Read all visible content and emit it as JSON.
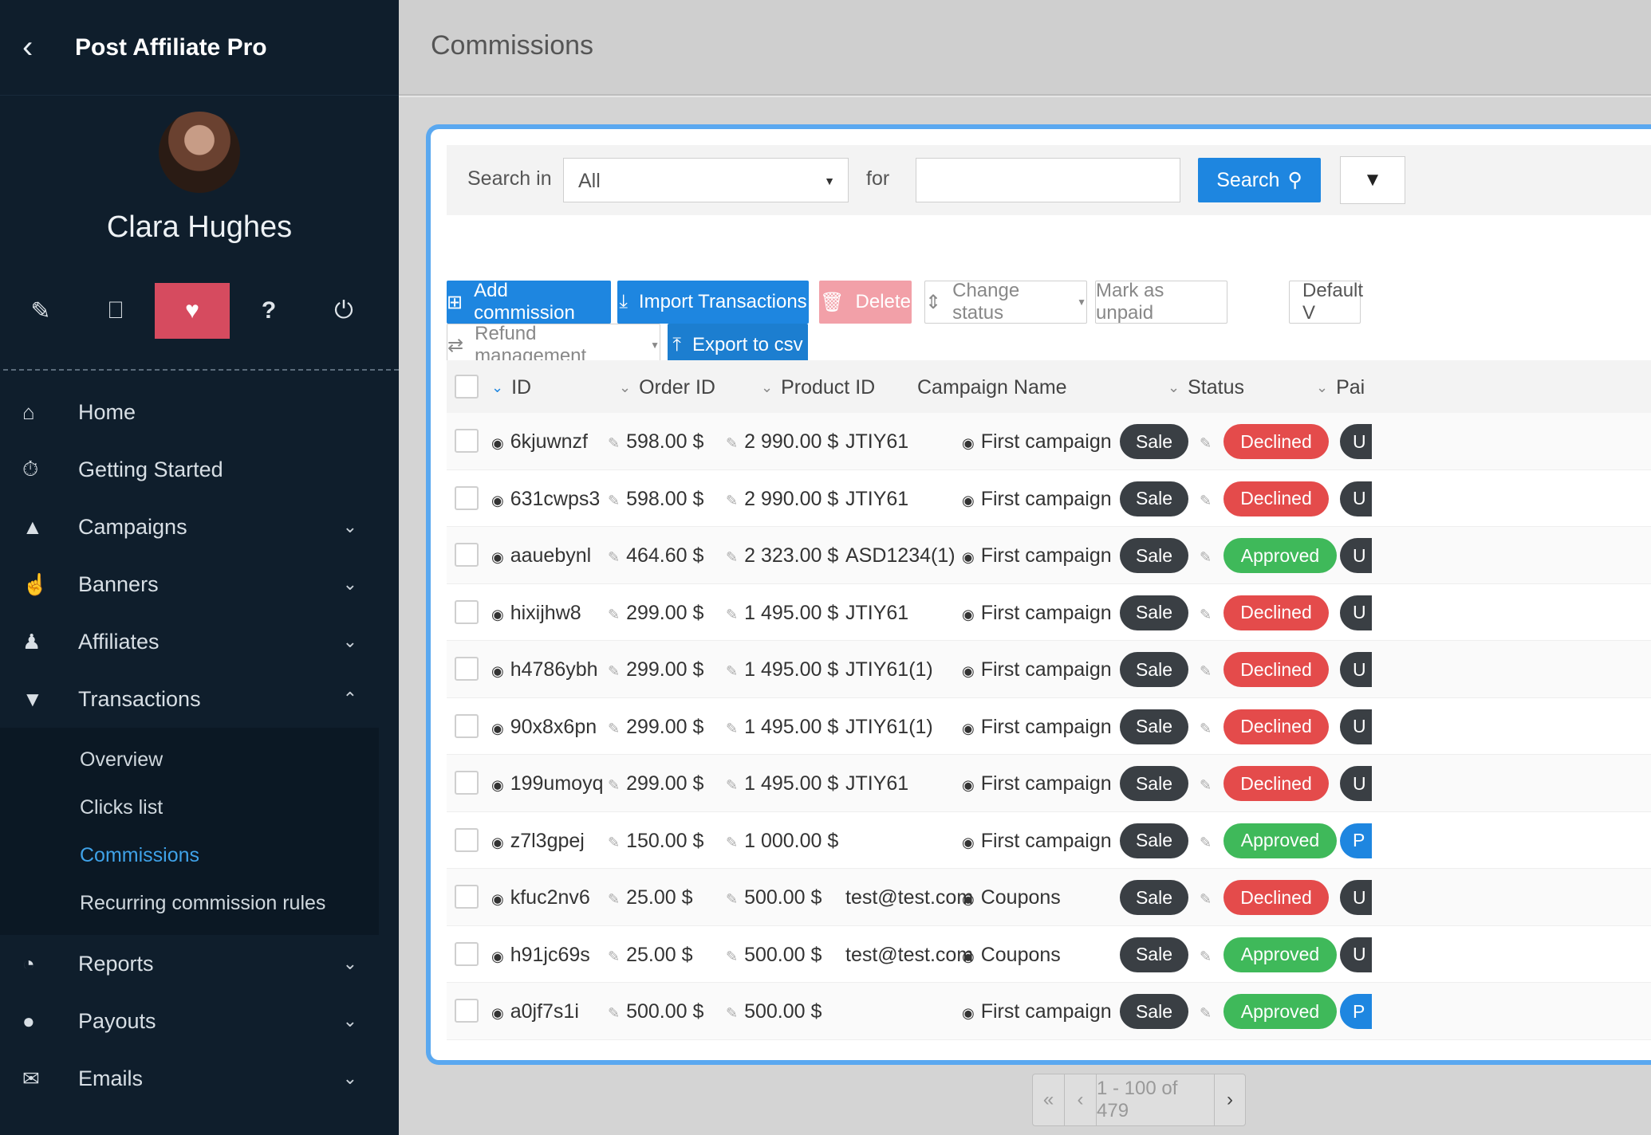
{
  "app": {
    "brand": "Post Affiliate Pro",
    "page_title": "Commissions"
  },
  "user": {
    "name": "Clara Hughes"
  },
  "quick_icons": [
    "pencil-icon",
    "monitor-icon",
    "heartbeat-icon",
    "question-icon",
    "power-icon"
  ],
  "nav": {
    "home": "Home",
    "getting_started": "Getting Started",
    "campaigns": "Campaigns",
    "banners": "Banners",
    "affiliates": "Affiliates",
    "transactions": "Transactions",
    "sub": {
      "overview": "Overview",
      "clicks_list": "Clicks list",
      "commissions": "Commissions",
      "recurring": "Recurring commission rules"
    },
    "reports": "Reports",
    "payouts": "Payouts",
    "emails": "Emails"
  },
  "search": {
    "search_in_label": "Search in",
    "search_in_value": "All",
    "for_label": "for",
    "for_value": "",
    "search_button": "Search"
  },
  "toolbar": {
    "add_commission": "Add commission",
    "import_transactions": "Import Transactions",
    "delete": "Delete",
    "change_status": "Change status",
    "mark_unpaid": "Mark as unpaid",
    "default_view": "Default V",
    "refund_management": "Refund management",
    "export_csv": "Export to csv"
  },
  "table": {
    "headers": {
      "id": "ID",
      "order_id": "Order ID",
      "product_id": "Product ID",
      "campaign_name": "Campaign Name",
      "status": "Status",
      "paid": "Pai"
    },
    "rows": [
      {
        "id": "6kjuwnzf",
        "commission": "598.00 $",
        "total": "2 990.00 $",
        "product": "JTIY61",
        "campaign": "First campaign",
        "type": "Sale",
        "status": "Declined",
        "paid": "U"
      },
      {
        "id": "631cwps3",
        "commission": "598.00 $",
        "total": "2 990.00 $",
        "product": "JTIY61",
        "campaign": "First campaign",
        "type": "Sale",
        "status": "Declined",
        "paid": "U"
      },
      {
        "id": "aauebynl",
        "commission": "464.60 $",
        "total": "2 323.00 $",
        "product": "ASD1234(1)",
        "campaign": "First campaign",
        "type": "Sale",
        "status": "Approved",
        "paid": "U"
      },
      {
        "id": "hixijhw8",
        "commission": "299.00 $",
        "total": "1 495.00 $",
        "product": "JTIY61",
        "campaign": "First campaign",
        "type": "Sale",
        "status": "Declined",
        "paid": "U"
      },
      {
        "id": "h4786ybh",
        "commission": "299.00 $",
        "total": "1 495.00 $",
        "product": "JTIY61(1)",
        "campaign": "First campaign",
        "type": "Sale",
        "status": "Declined",
        "paid": "U"
      },
      {
        "id": "90x8x6pn",
        "commission": "299.00 $",
        "total": "1 495.00 $",
        "product": "JTIY61(1)",
        "campaign": "First campaign",
        "type": "Sale",
        "status": "Declined",
        "paid": "U"
      },
      {
        "id": "199umoyq",
        "commission": "299.00 $",
        "total": "1 495.00 $",
        "product": "JTIY61",
        "campaign": "First campaign",
        "type": "Sale",
        "status": "Declined",
        "paid": "U"
      },
      {
        "id": "z7l3gpej",
        "commission": "150.00 $",
        "total": "1 000.00 $",
        "product": "",
        "campaign": "First campaign",
        "type": "Sale",
        "status": "Approved",
        "paid": "P"
      },
      {
        "id": "kfuc2nv6",
        "commission": "25.00 $",
        "total": "500.00 $",
        "product": "test@test.com",
        "campaign": "Coupons",
        "type": "Sale",
        "status": "Declined",
        "paid": "U"
      },
      {
        "id": "h91jc69s",
        "commission": "25.00 $",
        "total": "500.00 $",
        "product": "test@test.com",
        "campaign": "Coupons",
        "type": "Sale",
        "status": "Approved",
        "paid": "U"
      },
      {
        "id": "a0jf7s1i",
        "commission": "500.00 $",
        "total": "500.00 $",
        "product": "",
        "campaign": "First campaign",
        "type": "Sale",
        "status": "Approved",
        "paid": "P"
      }
    ]
  },
  "pagination": {
    "first": "«",
    "prev": "‹",
    "range": "1 - 100 of 479",
    "next": "›"
  },
  "colors": {
    "accent": "#1e86e0",
    "declined": "#e44b4b",
    "approved": "#3fb95a",
    "sidebar": "#0f1e2c",
    "active_quick": "#d64b5f"
  }
}
